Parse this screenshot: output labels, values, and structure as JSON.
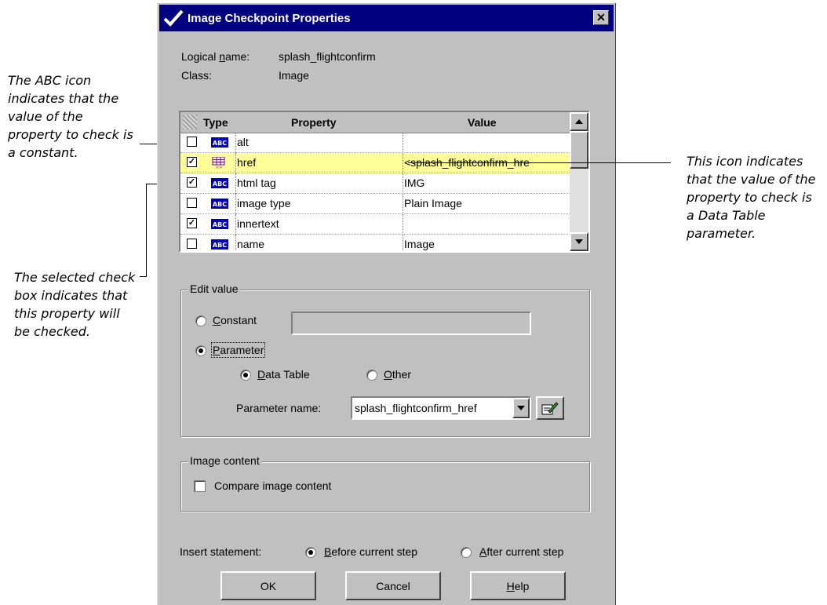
{
  "annotations": {
    "abc_note": [
      "The ABC icon",
      "indicates that the",
      "value of the",
      "property to check is",
      "a constant."
    ],
    "checkbox_note": [
      "The selected check",
      "box indicates that",
      "this property will",
      "be checked."
    ],
    "datatable_note": [
      "This icon indicates",
      "that the value of the",
      "property to check is",
      "a Data Table",
      "parameter."
    ]
  },
  "dialog": {
    "title": "Image Checkpoint Properties",
    "close_label": "✕",
    "logical_name_label_pre": "Logical ",
    "logical_name_label_ul": "n",
    "logical_name_label_post": "ame:",
    "logical_name_value": "splash_flightconfirm",
    "class_label": "Class:",
    "class_value": "Image"
  },
  "grid": {
    "columns": {
      "type": "Type",
      "property": "Property",
      "value": "Value"
    },
    "rows": [
      {
        "checked": false,
        "icon": "abc-icon",
        "property": "alt",
        "value": "",
        "highlight": false
      },
      {
        "checked": true,
        "icon": "datatable-icon",
        "property": "href",
        "value": "<splash_flightconfirm_hre",
        "highlight": true
      },
      {
        "checked": true,
        "icon": "abc-icon",
        "property": "html tag",
        "value": "IMG",
        "highlight": false
      },
      {
        "checked": false,
        "icon": "abc-icon",
        "property": "image type",
        "value": "Plain Image",
        "highlight": false
      },
      {
        "checked": true,
        "icon": "abc-icon",
        "property": "innertext",
        "value": "",
        "highlight": false
      },
      {
        "checked": false,
        "icon": "abc-icon",
        "property": "name",
        "value": "Image",
        "highlight": false
      }
    ]
  },
  "edit_value": {
    "group_label": "Edit value",
    "constant_ul": "C",
    "constant_rest": "onstant",
    "constant_value": "",
    "parameter_ul": "P",
    "parameter_rest": "arameter",
    "data_table_ul": "D",
    "data_table_rest": "ata Table",
    "other_ul": "O",
    "other_rest": "ther",
    "param_name_label": "Parameter name:",
    "param_name_value": "splash_flightconfirm_href"
  },
  "image_content": {
    "group_label": "Image content",
    "compare_label": "Compare image content",
    "compare_checked": false
  },
  "insert": {
    "label": "Insert statement:",
    "before_ul": "B",
    "before_rest": "efore current step",
    "after_ul": "A",
    "after_rest": "fter current step"
  },
  "buttons": {
    "ok": "OK",
    "cancel": "Cancel",
    "help_ul": "H",
    "help_rest": "elp"
  },
  "colors": {
    "titlebar": "#000080",
    "dialog_bg": "#c0c0c0",
    "highlight_row": "#ffff99",
    "abc_icon": "#0000c0"
  }
}
